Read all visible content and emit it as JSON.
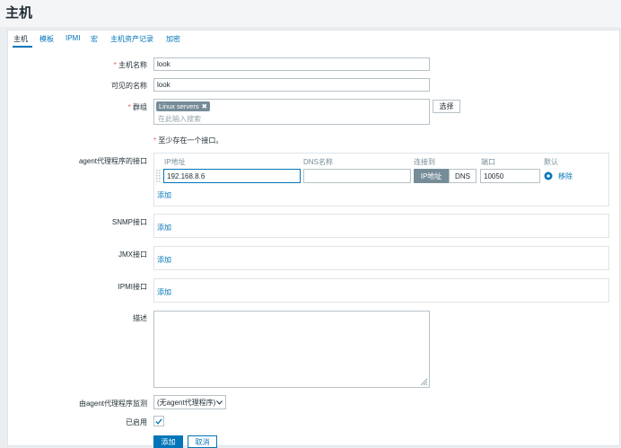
{
  "header": {
    "title": "主机"
  },
  "tabs": [
    "主机",
    "模板",
    "IPMI",
    "宏",
    "主机资产记录",
    "加密"
  ],
  "form": {
    "host_name": {
      "label": "主机名称",
      "required_mark": "*",
      "value": "look"
    },
    "visible_name": {
      "label": "可见的名称",
      "value": "look"
    },
    "groups": {
      "label": "群组",
      "required_mark": "*",
      "tag": "Linux servers",
      "tag_remove": "✖",
      "placeholder": "在此输入搜索",
      "select_button": "选择"
    },
    "interface_note": {
      "mark": "*",
      "text": "至少存在一个接口。"
    },
    "agent": {
      "label": "agent代理程序的接口",
      "columns": {
        "ip": "IP地址",
        "dns": "DNS名称",
        "connect": "连接到",
        "port": "端口",
        "default": "默认"
      },
      "row": {
        "ip": "192.168.8.6",
        "dns": "",
        "connect_ip": "IP地址",
        "connect_dns": "DNS",
        "port": "10050",
        "remove": "移除"
      },
      "add": "添加"
    },
    "snmp": {
      "label": "SNMP接口",
      "add": "添加"
    },
    "jmx": {
      "label": "JMX接口",
      "add": "添加"
    },
    "ipmi": {
      "label": "IPMI接口",
      "add": "添加"
    },
    "description": {
      "label": "描述",
      "value": ""
    },
    "proxy": {
      "label": "由agent代理程序监测",
      "selected": "(无agent代理程序)"
    },
    "enabled": {
      "label": "已启用",
      "checked": true
    },
    "buttons": {
      "add": "添加",
      "cancel": "取消"
    }
  }
}
